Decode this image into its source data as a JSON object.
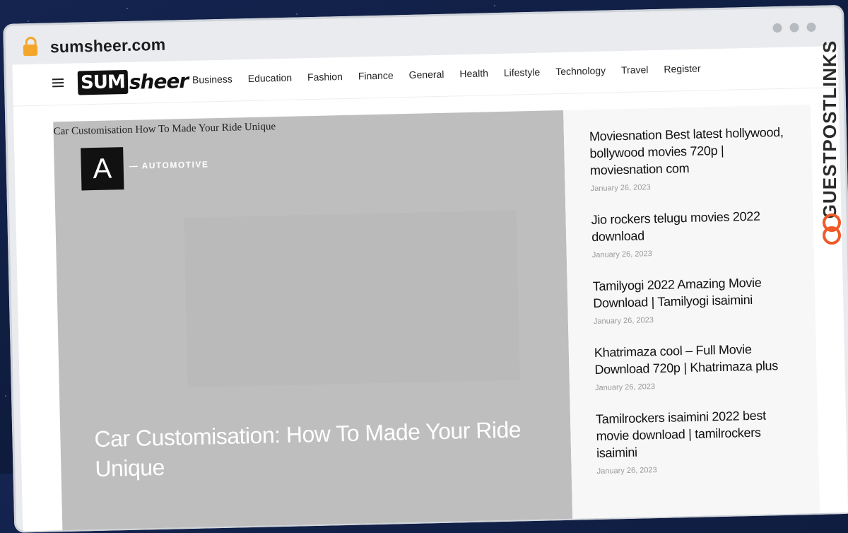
{
  "browser": {
    "url": "sumsheer.com"
  },
  "site": {
    "logo_part1": "SUM",
    "logo_part2": "sheer"
  },
  "nav": {
    "items": [
      "Business",
      "Education",
      "Fashion",
      "Finance",
      "General",
      "Health",
      "Lifestyle",
      "Technology",
      "Travel",
      "Register"
    ]
  },
  "hero": {
    "image_alt": "Car Customisation How To Made Your Ride Unique",
    "avatar_letter": "A",
    "category": "AUTOMOTIVE",
    "title": "Car Customisation: How To Made Your Ride Unique"
  },
  "sidebar": {
    "posts": [
      {
        "title": "Moviesnation Best latest hollywood, bollywood movies 720p | moviesnation com",
        "date": "January 26, 2023"
      },
      {
        "title": "Jio rockers telugu movies 2022 download",
        "date": "January 26, 2023"
      },
      {
        "title": "Tamilyogi 2022 Amazing Movie Download | Tamilyogi isaimini",
        "date": "January 26, 2023"
      },
      {
        "title": "Khatrimaza cool – Full Movie Download 720p | Khatrimaza plus",
        "date": "January 26, 2023"
      },
      {
        "title": "Tamilrockers isaimini 2022 best movie download | tamilrockers isaimini",
        "date": "January 26, 2023"
      }
    ]
  },
  "watermark": {
    "text": "GUESTPOSTLINKS"
  },
  "colors": {
    "accent": "#f05a28",
    "hero_bg": "#bdbebd",
    "lock": "#f4a62a"
  }
}
